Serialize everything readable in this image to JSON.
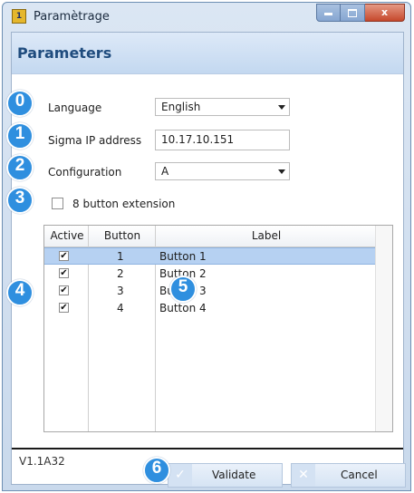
{
  "window": {
    "title": "Paramètrage",
    "app_icon_text": "1",
    "controls": {
      "minimize": "minimize",
      "maximize": "maximize",
      "close": "x"
    }
  },
  "header": {
    "title": "Parameters"
  },
  "steps": [
    "0",
    "1",
    "2",
    "3",
    "4",
    "5",
    "6"
  ],
  "form": {
    "language": {
      "label": "Language",
      "value": "English"
    },
    "sigma_ip": {
      "label": "Sigma IP address",
      "value": "10.17.10.151"
    },
    "configuration": {
      "label": "Configuration",
      "value": "A"
    },
    "extension": {
      "label": "8 button extension",
      "checked": false
    }
  },
  "grid": {
    "columns": [
      "Active",
      "Button",
      "Label"
    ],
    "rows": [
      {
        "active": true,
        "button": "1",
        "label": "Button 1",
        "selected": true
      },
      {
        "active": true,
        "button": "2",
        "label": "Button 2",
        "selected": false
      },
      {
        "active": true,
        "button": "3",
        "label": "Button 3",
        "selected": false
      },
      {
        "active": true,
        "button": "4",
        "label": "Button 4",
        "selected": false
      }
    ],
    "check_glyph": "✔"
  },
  "footer": {
    "version": "V1.1A32",
    "validate_label": "Validate",
    "cancel_label": "Cancel"
  },
  "colors": {
    "accent": "#2f8fdf",
    "header_text": "#1f4c7e",
    "selection": "#b6d1f2"
  }
}
